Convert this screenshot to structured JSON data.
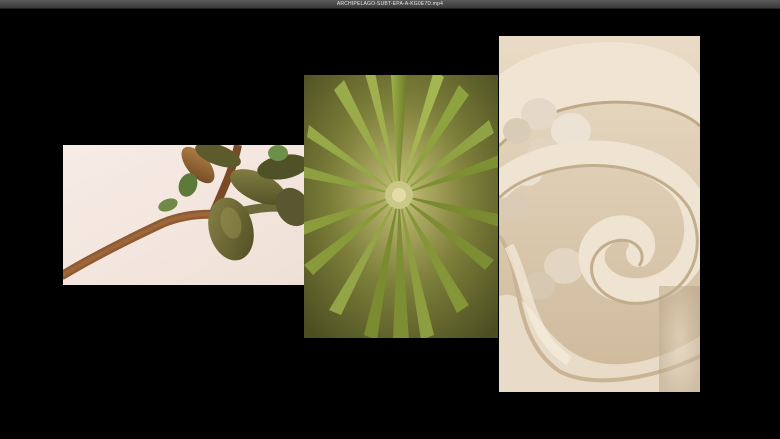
{
  "window": {
    "title": "ARCHIPELAGO-SUBT-EPA-A-KG0E7D.mp4"
  },
  "video": {
    "panels": [
      {
        "name": "jade-branch-photo"
      },
      {
        "name": "air-plant-photo"
      },
      {
        "name": "ceramic-spiral-photo"
      }
    ]
  },
  "colors": {
    "background": "#000000",
    "titlebar": "#4a4a4a",
    "branch_bg": "#f3e7df",
    "airplant_green": "#8c9a3e",
    "ceramic": "#e6d8c2"
  }
}
